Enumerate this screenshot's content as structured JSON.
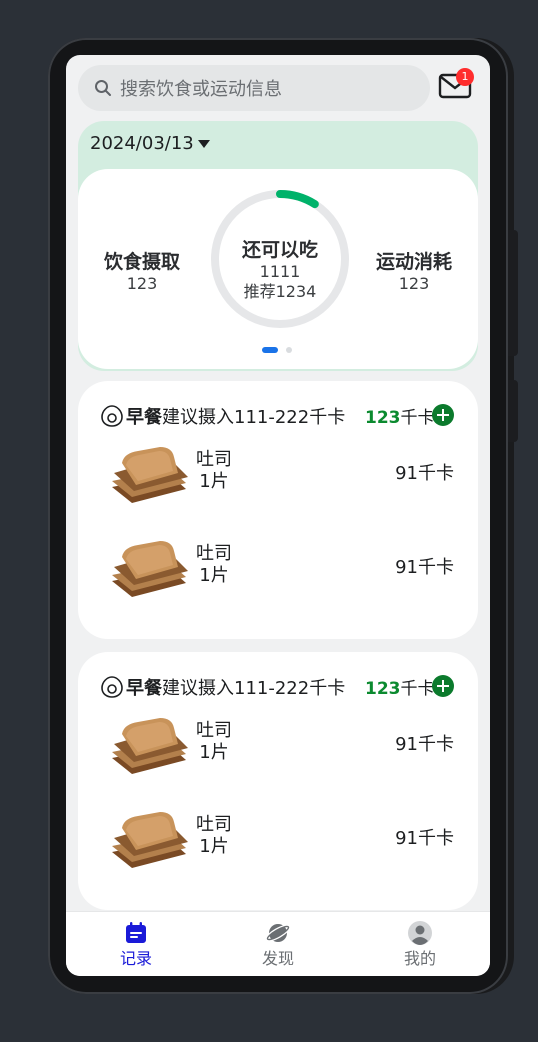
{
  "search": {
    "placeholder": "搜索饮食或运动信息"
  },
  "mail": {
    "badge": "1"
  },
  "summary": {
    "date": "2024/03/13",
    "intake": {
      "title": "饮食摄取",
      "value": "123"
    },
    "ring": {
      "title": "还可以吃",
      "value": "1111",
      "recommend": "推荐1234",
      "progress": 0.09
    },
    "exercise": {
      "title": "运动消耗",
      "value": "123"
    }
  },
  "meals": [
    {
      "name": "早餐",
      "suggest": "建议摄入111-222千卡",
      "kcal": "123",
      "unit": "千卡",
      "items": [
        {
          "name": "吐司",
          "qty": "1片",
          "kcal": "91千卡"
        },
        {
          "name": "吐司",
          "qty": "1片",
          "kcal": "91千卡"
        }
      ]
    },
    {
      "name": "早餐",
      "suggest": "建议摄入111-222千卡",
      "kcal": "123",
      "unit": "千卡",
      "items": [
        {
          "name": "吐司",
          "qty": "1片",
          "kcal": "91千卡"
        },
        {
          "name": "吐司",
          "qty": "1片",
          "kcal": "91千卡"
        }
      ]
    }
  ],
  "tabs": [
    {
      "label": "记录",
      "icon": "calendar-icon",
      "active": true
    },
    {
      "label": "发现",
      "icon": "planet-icon",
      "active": false
    },
    {
      "label": "我的",
      "icon": "profile-icon",
      "active": false
    }
  ],
  "colors": {
    "accent": "#1a73e8",
    "ring": "#00b26a",
    "calorie": "#0b8a2f",
    "summary_bg": "#d3ede0"
  }
}
